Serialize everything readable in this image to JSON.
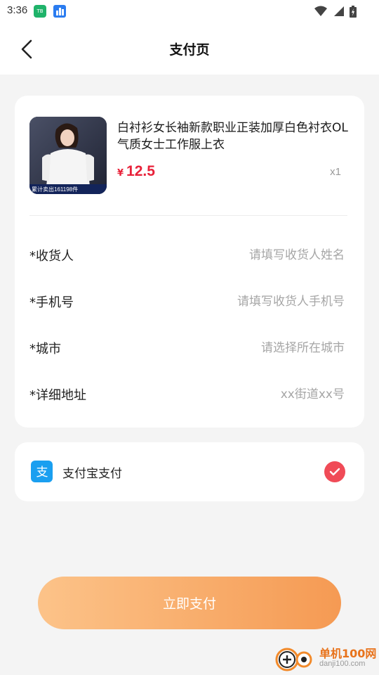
{
  "status_bar": {
    "time": "3:36",
    "app_icon_label": "TB"
  },
  "nav": {
    "title": "支付页"
  },
  "product": {
    "title": "白衬衫女长袖新款职业正装加厚白色衬衣OL气质女士工作服上衣",
    "price_symbol": "¥",
    "price": "12.5",
    "quantity": "x1",
    "image_banner": "累计卖出161198件"
  },
  "form": {
    "fields": [
      {
        "label": "*收货人",
        "placeholder": "请填写收货人姓名"
      },
      {
        "label": "*手机号",
        "placeholder": "请填写收货人手机号"
      },
      {
        "label": "*城市",
        "placeholder": "请选择所在城市"
      },
      {
        "label": "*详细地址",
        "placeholder": "xx街道xx号"
      }
    ]
  },
  "payment": {
    "method_label": "支付宝支付",
    "icon": "alipay-icon",
    "selected": true
  },
  "actions": {
    "pay_now": "立即支付"
  },
  "watermark": {
    "name": "单机100网",
    "url": "danji100.com"
  },
  "colors": {
    "price": "#e8223a",
    "check": "#f04b57",
    "alipay": "#1a9ff0",
    "button_start": "#fcc389",
    "button_end": "#f59a53"
  }
}
